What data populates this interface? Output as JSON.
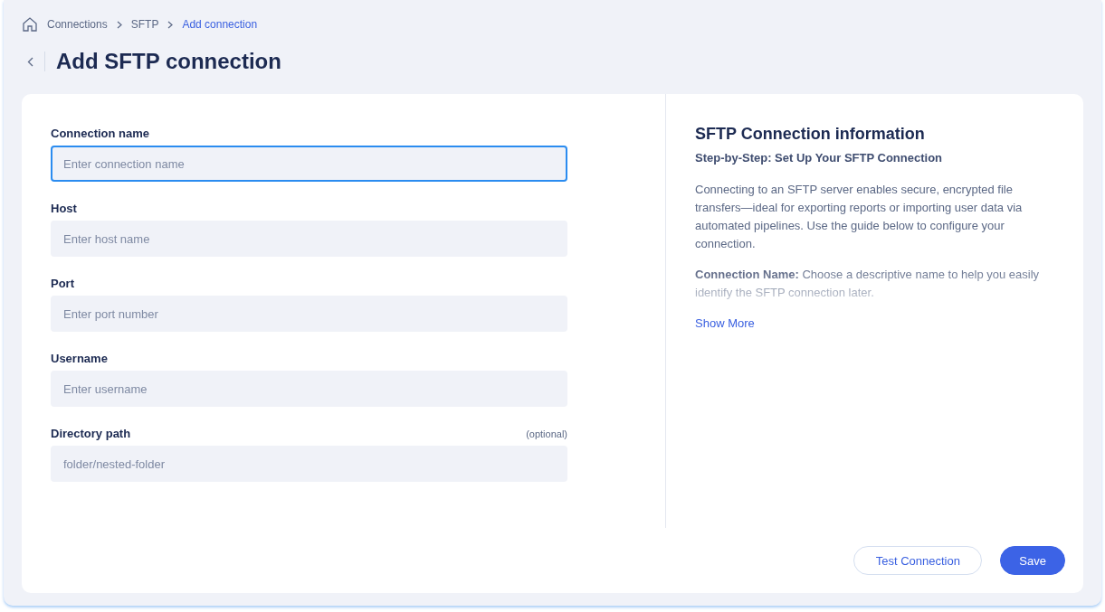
{
  "breadcrumbs": [
    {
      "label": "Connections",
      "current": false
    },
    {
      "label": "SFTP",
      "current": false
    },
    {
      "label": "Add connection",
      "current": true
    }
  ],
  "title": "Add SFTP connection",
  "form": {
    "fields": [
      {
        "label": "Connection name",
        "placeholder": "Enter connection name",
        "focused": true
      },
      {
        "label": "Host",
        "placeholder": "Enter host name",
        "focused": false
      },
      {
        "label": "Port",
        "placeholder": "Enter port number",
        "focused": false
      },
      {
        "label": "Username",
        "placeholder": "Enter username",
        "focused": false
      },
      {
        "label": "Directory path",
        "note": "(optional)",
        "placeholder": "folder/nested-folder",
        "focused": false
      }
    ]
  },
  "info": {
    "title": "SFTP Connection information",
    "subtitle": "Step-by-Step: Set Up Your SFTP Connection",
    "paragraphs": [
      "Connecting to an SFTP server enables secure, encrypted file transfers—ideal for exporting reports or importing user data via automated pipelines. Use the guide below to configure your connection.",
      "**Connection Name:** Choose a descriptive name to help you easily identify the SFTP connection later."
    ],
    "show_more": "Show More"
  },
  "buttons": [
    {
      "label": "Test Connection",
      "kind": "secondary"
    },
    {
      "label": "Save",
      "kind": "primary"
    }
  ]
}
